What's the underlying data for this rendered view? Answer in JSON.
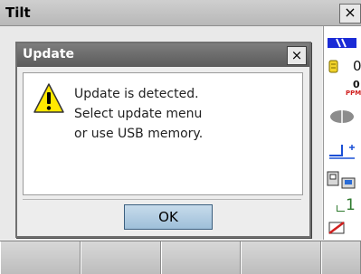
{
  "window": {
    "title": "Tilt",
    "close_label": "×"
  },
  "dialog": {
    "title": "Update",
    "close_label": "×",
    "message_lines": [
      "Update is detected.",
      "Select update menu",
      "or use USB memory."
    ],
    "ok_label": "OK"
  },
  "status": {
    "value_c": "0",
    "value_small": "0",
    "ppm_label": "PPM",
    "counter": "1"
  },
  "colors": {
    "battery": "#1a2bd6",
    "ppm": "#d0201f",
    "memory": "#2f7a2f"
  }
}
